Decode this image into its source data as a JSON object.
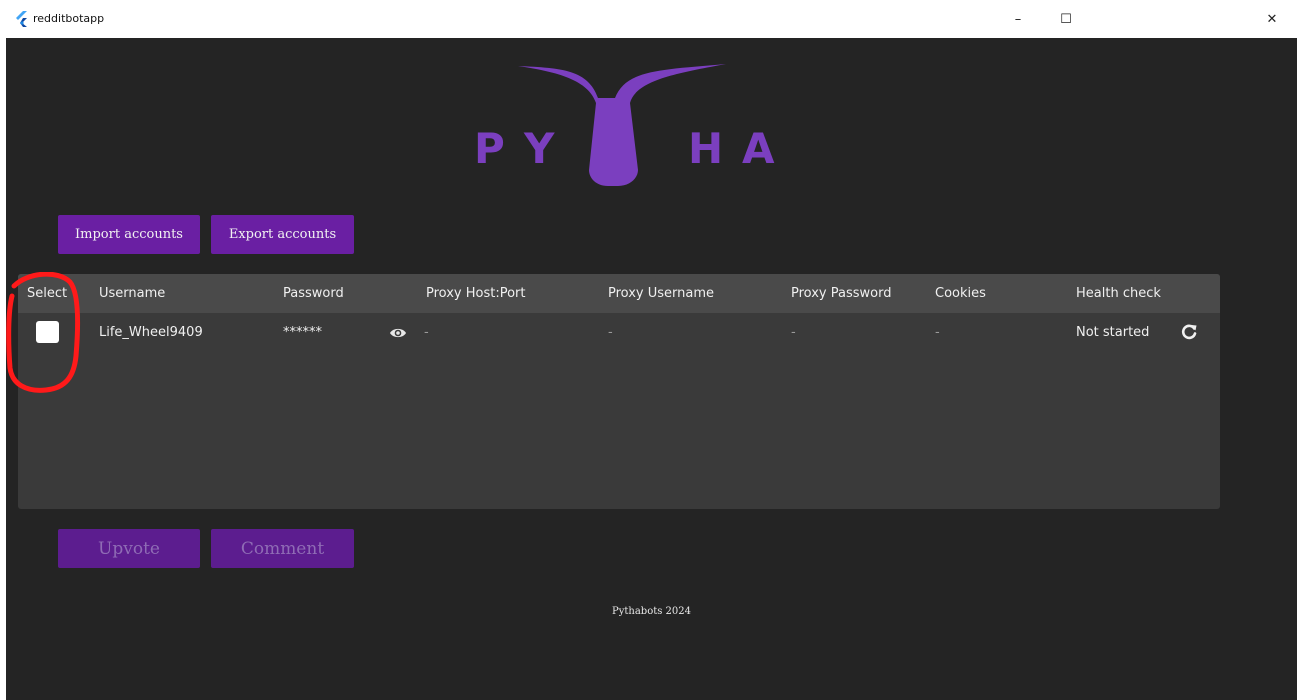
{
  "window": {
    "title": "redditbotapp",
    "controls": {
      "minimize": "–",
      "maximize": "☐",
      "close": "✕"
    }
  },
  "logo": {
    "letters": [
      "P",
      "Y",
      "H",
      "A"
    ],
    "color": "#7b3fbf"
  },
  "toolbar": {
    "import_label": "Import accounts",
    "export_label": "Export accounts"
  },
  "table": {
    "columns": [
      "Select",
      "Username",
      "Password",
      "Proxy Host:Port",
      "Proxy Username",
      "Proxy Password",
      "Cookies",
      "Health check"
    ],
    "rows": [
      {
        "selected": false,
        "username": "Life_Wheel9409",
        "password": "******",
        "proxy_host_port": "-",
        "proxy_username": "-",
        "proxy_password": "-",
        "cookies": "-",
        "health_check": "Not started",
        "icons": {
          "reveal": "eye-icon",
          "refresh": "refresh-icon"
        }
      }
    ]
  },
  "actions": {
    "upvote_label": "Upvote",
    "comment_label": "Comment"
  },
  "footer": {
    "text": "Pythabots 2024"
  },
  "colors": {
    "accent": "#6a1fa3",
    "background": "#242424",
    "table_bg": "#3a3a3a",
    "header_bg": "#4a4a4a",
    "annotation": "#ff1a1a"
  }
}
